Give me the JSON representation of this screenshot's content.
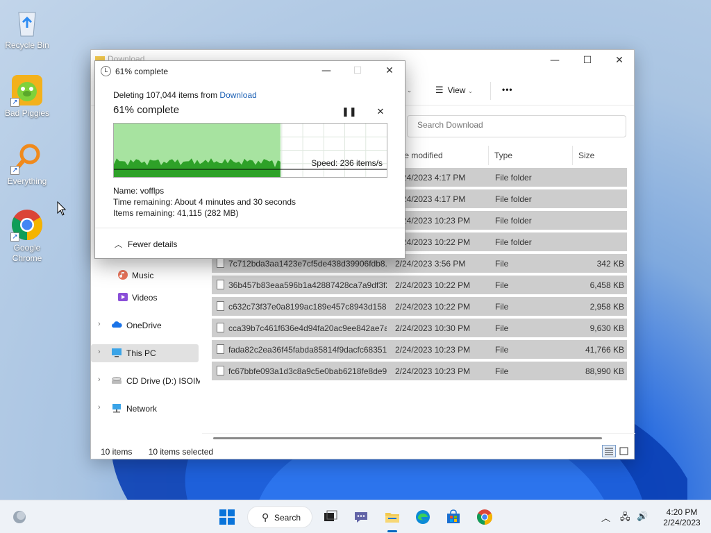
{
  "desktop": {
    "icons": [
      {
        "label": "Recycle Bin",
        "icon": "recycle-bin-icon"
      },
      {
        "label": "Bad Piggies",
        "icon": "bad-piggies-icon"
      },
      {
        "label": "Everything",
        "icon": "everything-search-icon"
      },
      {
        "label": "Google Chrome",
        "icon": "chrome-icon"
      }
    ]
  },
  "explorer": {
    "title": "Download",
    "toolbar": {
      "sort_suffix": "t",
      "view_label": "View",
      "more_label": "•••"
    },
    "search_placeholder": "Search Download",
    "columns": {
      "date": "te modified",
      "type": "Type",
      "size": "Size"
    },
    "folder_rows": [
      {
        "date": "2/24/2023 4:17 PM",
        "type": "File folder"
      },
      {
        "date": "2/24/2023 4:17 PM",
        "type": "File folder"
      },
      {
        "date": "2/24/2023 10:23 PM",
        "type": "File folder"
      },
      {
        "date": "2/24/2023 10:22 PM",
        "type": "File folder"
      }
    ],
    "file_rows": [
      {
        "name": "7c712bda3aa1423e7cf5de438d39906fdb8...",
        "date": "2/24/2023 3:56 PM",
        "type": "File",
        "size": "342 KB"
      },
      {
        "name": "36b457b83eaa596b1a42887428ca7a9df3f2...",
        "date": "2/24/2023 10:22 PM",
        "type": "File",
        "size": "6,458 KB"
      },
      {
        "name": "c632c73f37e0a8199ac189e457c8943d158b...",
        "date": "2/24/2023 10:22 PM",
        "type": "File",
        "size": "2,958 KB"
      },
      {
        "name": "cca39b7c461f636e4d94fa20ac9ee842ae7a...",
        "date": "2/24/2023 10:30 PM",
        "type": "File",
        "size": "9,630 KB"
      },
      {
        "name": "fada82c2ea36f45fabda85814f9dacfc68351...",
        "date": "2/24/2023 10:23 PM",
        "type": "File",
        "size": "41,766 KB"
      },
      {
        "name": "fc67bbfe093a1d3c8a9c5e0bab6218fe8de9...",
        "date": "2/24/2023 10:23 PM",
        "type": "File",
        "size": "88,990 KB"
      }
    ],
    "nav": {
      "music": "Music",
      "videos": "Videos",
      "onedrive": "OneDrive",
      "this_pc": "This PC",
      "cd_drive": "CD Drive (D:) ISOIM/",
      "network": "Network"
    },
    "status": {
      "items": "10 items",
      "selected": "10 items selected"
    }
  },
  "dialog": {
    "title": "61% complete",
    "line_prefix": "Deleting 107,044 items from ",
    "line_link": "Download",
    "big_status": "61% complete",
    "percent": 61,
    "speed": "Speed: 236 items/s",
    "name_label": "Name:",
    "name_value": "vofflps",
    "time_label": "Time remaining:",
    "time_value": "About 4 minutes and 30 seconds",
    "items_label": "Items remaining:",
    "items_value": "41,115 (282 MB)",
    "fewer_details": "Fewer details",
    "colors": {
      "fill": "#a7e3a0",
      "line": "#2ea128"
    }
  },
  "taskbar": {
    "search_label": "Search",
    "time": "4:20 PM",
    "date": "2/24/2023"
  }
}
